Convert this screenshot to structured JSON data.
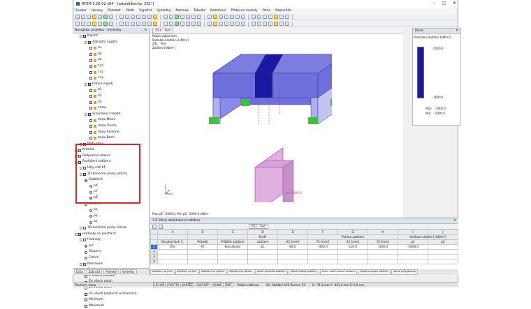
{
  "app": {
    "title": "RFEM 5.26.02 x64 - [zatahblbeche, ZS1*]"
  },
  "menu": [
    "Soubor",
    "Úpravy",
    "Zobrazit",
    "Vložit",
    "Výpočet",
    "Výsledky",
    "Nástroje",
    "Tabulka",
    "Nastavení",
    "Přídavné moduly",
    "Okno",
    "Nápověda"
  ],
  "toolbar": {
    "combo": "ZS1 - Test"
  },
  "navigator": {
    "title": "Navigátor projektu - Výsledky",
    "items": [
      {
        "label": "Napětí",
        "level": 1,
        "check": "on",
        "kind": "ex"
      },
      {
        "label": "Základní napětí",
        "level": 2,
        "check": "on",
        "kind": "ex"
      },
      {
        "label": "σx",
        "level": 3,
        "check": "off",
        "kind": "ic"
      },
      {
        "label": "σy",
        "level": 3,
        "check": "off",
        "kind": "ic"
      },
      {
        "label": "σz",
        "level": 3,
        "check": "off",
        "kind": "ic"
      },
      {
        "label": "τyz",
        "level": 3,
        "check": "off",
        "kind": "ic"
      },
      {
        "label": "τxz",
        "level": 3,
        "check": "off",
        "kind": "ic"
      },
      {
        "label": "τxy",
        "level": 3,
        "check": "off",
        "kind": "ic"
      },
      {
        "label": "Hlavní napětí",
        "level": 2,
        "check": "on",
        "kind": "ex"
      },
      {
        "label": "σ1",
        "level": 3,
        "check": "off",
        "kind": "ic"
      },
      {
        "label": "σ2",
        "level": 3,
        "check": "off",
        "kind": "ic"
      },
      {
        "label": "σ3",
        "level": 3,
        "check": "off",
        "kind": "ic"
      },
      {
        "label": "τmax",
        "level": 3,
        "check": "off",
        "kind": "ic"
      },
      {
        "label": "Srovnávací napětí",
        "level": 2,
        "check": "on",
        "kind": "ex"
      },
      {
        "label": "σeqv,Mises",
        "level": 3,
        "check": "off",
        "kind": "ic"
      },
      {
        "label": "σeqv,Tresca",
        "level": 3,
        "check": "off",
        "kind": "ic"
      },
      {
        "label": "σeqv,Rankine",
        "level": 3,
        "check": "off",
        "kind": "ic"
      },
      {
        "label": "σeqv,Bach",
        "level": 3,
        "check": "off",
        "kind": "ic"
      },
      {
        "label": "Přetvoření",
        "level": 1,
        "check": "off",
        "kind": "ex"
      },
      {
        "label": "Kritéria",
        "level": 0,
        "check": "off",
        "kind": "ex"
      },
      {
        "label": "Podporové reakce",
        "level": 0,
        "check": "off",
        "kind": "ex"
      },
      {
        "label": "Rozložení zatížení",
        "level": 0,
        "check": "on",
        "kind": "ex"
      },
      {
        "label": "Uzly sítě KP",
        "level": 1,
        "check": "off",
        "kind": "ex"
      },
      {
        "label": "2D konečné prvky plochy",
        "level": 1,
        "check": "on",
        "kind": "ex"
      },
      {
        "label": "Globálně",
        "level": 2,
        "check": "on",
        "kind": "rad"
      },
      {
        "label": "pX",
        "level": 3,
        "check": "off",
        "kind": "rad"
      },
      {
        "label": "pY",
        "level": 3,
        "check": "off",
        "kind": "rad"
      },
      {
        "label": "pZ",
        "level": 3,
        "check": "on",
        "kind": "rad"
      },
      {
        "label": "Lokálně",
        "level": 2,
        "check": "off",
        "kind": "rad"
      },
      {
        "label": "px",
        "level": 3,
        "check": "off",
        "kind": "rad"
      },
      {
        "label": "py",
        "level": 3,
        "check": "off",
        "kind": "rad"
      },
      {
        "label": "pz",
        "level": 3,
        "check": "off",
        "kind": "rad"
      },
      {
        "label": "3D konečné prvky tělesa",
        "level": 1,
        "check": "off",
        "kind": "ex"
      },
      {
        "label": "Hodnoty na plochách",
        "level": 0,
        "check": "on",
        "kind": "ex"
      },
      {
        "label": "Hodnoty",
        "level": 1,
        "check": "off",
        "kind": "ex"
      },
      {
        "label": "p,z",
        "level": 2,
        "check": "on",
        "kind": "rad"
      },
      {
        "label": "Skupiny",
        "level": 2,
        "check": "off",
        "kind": "rad"
      },
      {
        "label": "Citlivé",
        "level": 2,
        "check": "off",
        "kind": "rad"
      },
      {
        "label": "Nastavení",
        "level": 1,
        "check": "off",
        "kind": "ex"
      },
      {
        "label": "Extrémní hodnoty",
        "level": 1,
        "check": "on",
        "kind": "ex"
      },
      {
        "label": "Z celého modelu",
        "level": 2,
        "check": "off",
        "kind": "ck"
      },
      {
        "label": "Ze všech ploch",
        "level": 2,
        "check": "off",
        "kind": "ck"
      },
      {
        "label": "Ze všech těles",
        "level": 2,
        "check": "off",
        "kind": "ck"
      },
      {
        "label": "Ze všech lokálních extrémních",
        "level": 2,
        "check": "on",
        "kind": "ck"
      },
      {
        "label": "Minimum",
        "level": 2,
        "check": "on",
        "kind": "ck"
      },
      {
        "label": "Maximum",
        "level": 2,
        "check": "on",
        "kind": "ck"
      }
    ],
    "tabs": [
      "Data",
      "Zobrazit",
      "Pohledy",
      "Výsledky"
    ]
  },
  "view": {
    "info": [
      "Režim vlákenních",
      "Rozložení zatížení [kN/m²]",
      "ZS1 : Test",
      "Zatížení [kN/m²]"
    ],
    "footer": "Max pZ: -5000.0, Min pZ: -5000.0 kN/m²",
    "load_label": "pz: -5000.0"
  },
  "panel": {
    "title": "Panel",
    "subtitle": "Rozložení zatížení [kN/m²]",
    "top": "-5000.0",
    "bottom": "-5000.0",
    "max_label": "Max:",
    "max": "-5000.0",
    "min_label": "Min:",
    "min": "-5000.0",
    "bar_color": "#1a1aa0"
  },
  "table": {
    "title": "3.6 Volná obdélníková zatížení",
    "combo": "ZS1 - Test",
    "letters": [
      "A",
      "B",
      "C",
      "D",
      "E",
      "F",
      "G",
      "H",
      "I",
      "J"
    ],
    "hdr1": [
      "",
      "Směr",
      "",
      "Poloha zatížení",
      "",
      "",
      "Velikost zatížení [kN/m²]",
      ""
    ],
    "hdr2": [
      "Na plochách č.",
      "Průmět",
      "Průběh zatížení",
      "zatížení",
      "X1 [mm]",
      "Y1 [mm]",
      "X2 [mm]",
      "Y2 [mm]",
      "p1",
      "p2"
    ],
    "rows": [
      [
        "1",
        "Vše",
        "XY",
        "Konstantní",
        "ZL",
        "90.0",
        "-400.0",
        "110.0",
        "-500.0",
        "-5000.0",
        ""
      ],
      [
        "2",
        "",
        "",
        "",
        "",
        "",
        "",
        "",
        "",
        "",
        ""
      ],
      [
        "3",
        "",
        "",
        "",
        "",
        "",
        "",
        "",
        "",
        "",
        ""
      ],
      [
        "4",
        "",
        "",
        "",
        "",
        "",
        "",
        "",
        "",
        "",
        ""
      ]
    ],
    "sheets": [
      "Zatížení na prut",
      "Zatížení na linii",
      "Zatížení na plochu",
      "Zatížení na těleso",
      "Volná osamělá zatížení",
      "Volná liniová zatížení",
      "Volná obdélníková zatížení",
      "Volná kruhová zatížení",
      "Volná polygonová"
    ]
  },
  "status": {
    "left": "Plochový vstup",
    "items": [
      "UCHOP",
      "RASTR",
      "KARTÉZ",
      "SUCHOP",
      "VLINIE",
      "DXF"
    ],
    "right1": "Režim vidlávací",
    "right2": "SS: Globální XYZ Rovina: XY",
    "coords": "X: -74.1 mm   Y: -451.4 mm   Z: 0.0 mm"
  }
}
